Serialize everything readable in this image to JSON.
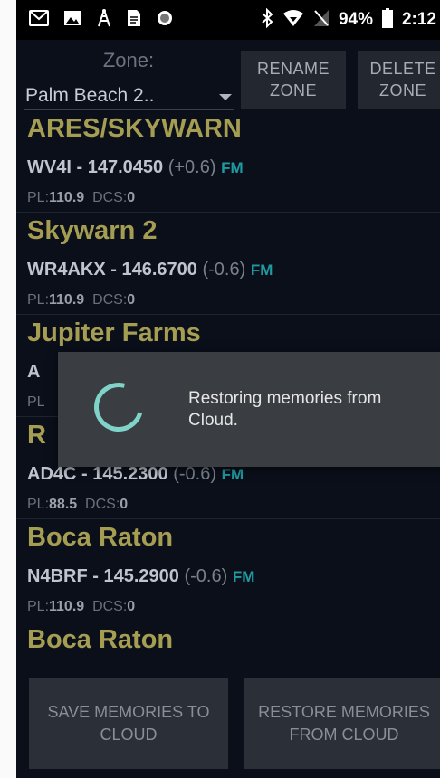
{
  "status_bar": {
    "icons_left": [
      "gmail-icon",
      "image-icon",
      "tower-icon",
      "document-icon",
      "circle-icon"
    ],
    "icons_right": [
      "bluetooth-icon",
      "wifi-icon",
      "no-signal-icon",
      "battery-icon"
    ],
    "battery": "94%",
    "time": "2:12"
  },
  "zone": {
    "label": "Zone:",
    "value": "Palm Beach 2..",
    "rename_label": "RENAME ZONE",
    "delete_label": "DELETE ZONE"
  },
  "memories": [
    {
      "name": "ARES/SKYWARN",
      "callsign": "WV4I",
      "freq": "147.0450",
      "offset": "(+0.6)",
      "mode": "FM",
      "pl_label": "PL:",
      "pl": "110.9",
      "dcs_label": "DCS:",
      "dcs": "0"
    },
    {
      "name": "Skywarn 2",
      "callsign": "WR4AKX",
      "freq": "146.6700",
      "offset": "(-0.6)",
      "mode": "FM",
      "pl_label": "PL:",
      "pl": "110.9",
      "dcs_label": "DCS:",
      "dcs": "0"
    },
    {
      "name": "Jupiter Farms",
      "callsign": "A",
      "freq": "",
      "offset": "",
      "mode": "",
      "pl_label": "PL",
      "pl": "",
      "dcs_label": "",
      "dcs": ""
    },
    {
      "name": "R",
      "callsign": "AD4C",
      "freq": "145.2300",
      "offset": "(-0.6)",
      "mode": "FM",
      "pl_label": "PL:",
      "pl": "88.5",
      "dcs_label": "DCS:",
      "dcs": "0"
    },
    {
      "name": "Boca Raton",
      "callsign": "N4BRF",
      "freq": "145.2900",
      "offset": "(-0.6)",
      "mode": "FM",
      "pl_label": "PL:",
      "pl": "110.9",
      "dcs_label": "DCS:",
      "dcs": "0"
    },
    {
      "name": "Boca Raton",
      "callsign": "",
      "freq": "",
      "offset": "",
      "mode": "",
      "pl_label": "",
      "pl": "",
      "dcs_label": "",
      "dcs": ""
    }
  ],
  "separator": "-",
  "dialog": {
    "message": "Restoring memories from Cloud."
  },
  "bottom": {
    "save_label": "SAVE MEMORIES TO CLOUD",
    "restore_label": "RESTORE MEMORIES FROM CLOUD"
  },
  "colors": {
    "name": "#a59d52",
    "mode": "#1e9aa0",
    "spinner": "#7fd3c9",
    "background": "#0a0f1a"
  }
}
